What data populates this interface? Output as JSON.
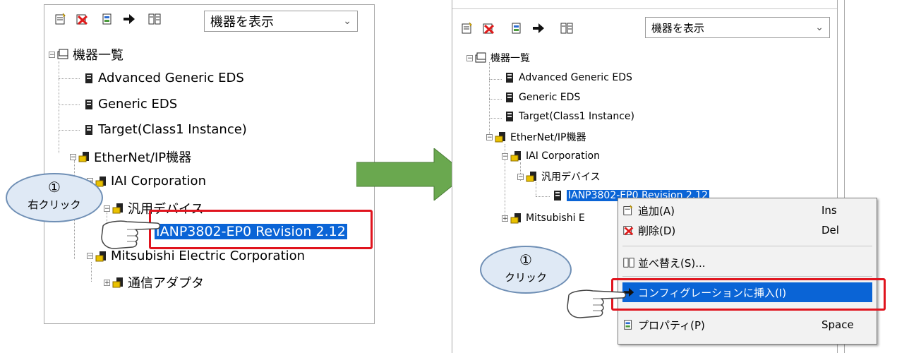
{
  "left": {
    "dropdown_value": "機器を表示",
    "tree": {
      "root": "機器一覧",
      "adv_eds": "Advanced Generic EDS",
      "generic_eds": "Generic EDS",
      "target": "Target(Class1 Instance)",
      "ethernet": "EtherNet/IP機器",
      "iai": "IAI Corporation",
      "generic_device": "汎用デバイス",
      "device": "IANP3802-EP0 Revision 2.12",
      "mitsubishi": "Mitsubishi Electric Corporation",
      "adapter": "通信アダプタ"
    },
    "callout": {
      "num": "①",
      "text": "右クリック"
    }
  },
  "right": {
    "dropdown_value": "機器を表示",
    "tree": {
      "root": "機器一覧",
      "adv_eds": "Advanced Generic EDS",
      "generic_eds": "Generic EDS",
      "target": "Target(Class1 Instance)",
      "ethernet": "EtherNet/IP機器",
      "iai": "IAI Corporation",
      "generic_device": "汎用デバイス",
      "device": "IANP3802-EP0 Revision 2.12",
      "mitsubishi": "Mitsubishi E"
    },
    "context_menu": {
      "add": {
        "label": "追加(A)",
        "shortcut": "Ins"
      },
      "delete": {
        "label": "削除(D)",
        "shortcut": "Del"
      },
      "sort": {
        "label": "並べ替え(S)..."
      },
      "insert": {
        "label": "コンフィグレーションに挿入(I)"
      },
      "property": {
        "label": "プロパティ(P)",
        "shortcut": "Space"
      }
    },
    "callout": {
      "num": "①",
      "text": "クリック"
    }
  },
  "colors": {
    "selection": "#0a64d6",
    "highlight_box": "#e0141e",
    "arrow": "#6aa84f"
  },
  "icons": [
    "add-device-icon",
    "delete-device-icon",
    "insert-icon",
    "arrow-right-icon",
    "sort-icon",
    "device-icon",
    "folder-device-icon",
    "pointing-hand-icon"
  ]
}
